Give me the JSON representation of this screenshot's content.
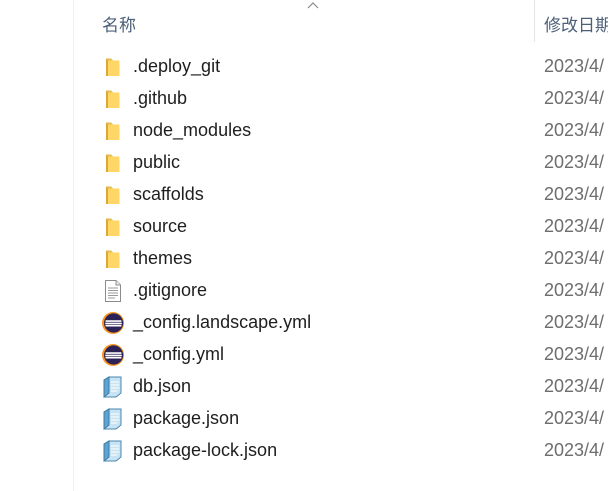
{
  "header": {
    "name_label": "名称",
    "date_label": "修改日期"
  },
  "files": [
    {
      "name": ".deploy_git",
      "date": "2023/4/",
      "icon": "folder-icon"
    },
    {
      "name": ".github",
      "date": "2023/4/",
      "icon": "folder-icon"
    },
    {
      "name": "node_modules",
      "date": "2023/4/",
      "icon": "folder-icon"
    },
    {
      "name": "public",
      "date": "2023/4/",
      "icon": "folder-icon"
    },
    {
      "name": "scaffolds",
      "date": "2023/4/",
      "icon": "folder-icon"
    },
    {
      "name": "source",
      "date": "2023/4/",
      "icon": "folder-icon"
    },
    {
      "name": "themes",
      "date": "2023/4/",
      "icon": "folder-icon"
    },
    {
      "name": ".gitignore",
      "date": "2023/4/",
      "icon": "text-file-icon"
    },
    {
      "name": "_config.landscape.yml",
      "date": "2023/4/",
      "icon": "eclipse-icon"
    },
    {
      "name": "_config.yml",
      "date": "2023/4/",
      "icon": "eclipse-icon"
    },
    {
      "name": "db.json",
      "date": "2023/4/",
      "icon": "json-file-icon"
    },
    {
      "name": "package.json",
      "date": "2023/4/",
      "icon": "json-file-icon"
    },
    {
      "name": "package-lock.json",
      "date": "2023/4/",
      "icon": "json-file-icon"
    }
  ]
}
